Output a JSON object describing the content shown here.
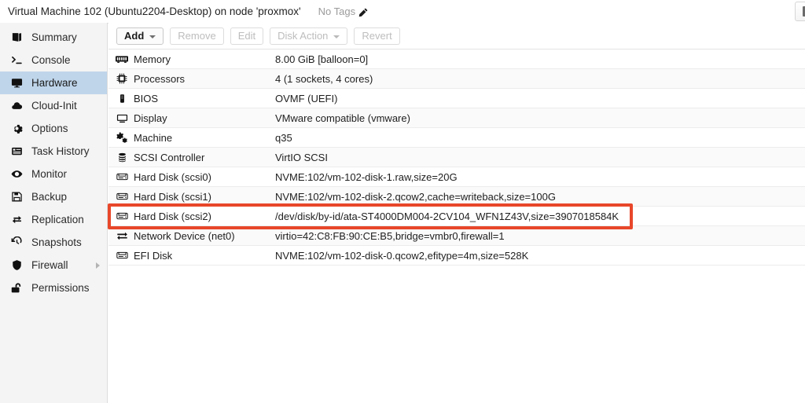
{
  "header": {
    "title": "Virtual Machine 102 (Ubuntu2204-Desktop) on node 'proxmox'",
    "tags_label": "No Tags",
    "edit_tags_icon": "pencil-icon"
  },
  "sidebar": {
    "items": [
      {
        "label": "Summary",
        "icon": "book-icon",
        "selected": false,
        "submenu": false
      },
      {
        "label": "Console",
        "icon": "terminal-icon",
        "selected": false,
        "submenu": false
      },
      {
        "label": "Hardware",
        "icon": "monitor-icon",
        "selected": true,
        "submenu": false
      },
      {
        "label": "Cloud-Init",
        "icon": "cloud-icon",
        "selected": false,
        "submenu": false
      },
      {
        "label": "Options",
        "icon": "gear-icon",
        "selected": false,
        "submenu": false
      },
      {
        "label": "Task History",
        "icon": "list-icon",
        "selected": false,
        "submenu": false
      },
      {
        "label": "Monitor",
        "icon": "eye-icon",
        "selected": false,
        "submenu": false
      },
      {
        "label": "Backup",
        "icon": "floppy-icon",
        "selected": false,
        "submenu": false
      },
      {
        "label": "Replication",
        "icon": "replication-icon",
        "selected": false,
        "submenu": false
      },
      {
        "label": "Snapshots",
        "icon": "history-icon",
        "selected": false,
        "submenu": false
      },
      {
        "label": "Firewall",
        "icon": "shield-icon",
        "selected": false,
        "submenu": true
      },
      {
        "label": "Permissions",
        "icon": "unlock-icon",
        "selected": false,
        "submenu": false
      }
    ]
  },
  "toolbar": {
    "buttons": [
      {
        "label": "Add",
        "enabled": true,
        "caret": true
      },
      {
        "label": "Remove",
        "enabled": false,
        "caret": false
      },
      {
        "label": "Edit",
        "enabled": false,
        "caret": false
      },
      {
        "label": "Disk Action",
        "enabled": false,
        "caret": true
      },
      {
        "label": "Revert",
        "enabled": false,
        "caret": false
      }
    ]
  },
  "hardware": {
    "rows": [
      {
        "icon": "memory-icon",
        "key": "Memory",
        "value": "8.00 GiB [balloon=0]"
      },
      {
        "icon": "cpu-icon",
        "key": "Processors",
        "value": "4 (1 sockets, 4 cores)"
      },
      {
        "icon": "bios-icon",
        "key": "BIOS",
        "value": "OVMF (UEFI)"
      },
      {
        "icon": "display-icon",
        "key": "Display",
        "value": "VMware compatible (vmware)"
      },
      {
        "icon": "gears-icon",
        "key": "Machine",
        "value": "q35"
      },
      {
        "icon": "database-icon",
        "key": "SCSI Controller",
        "value": "VirtIO SCSI"
      },
      {
        "icon": "harddisk-icon",
        "key": "Hard Disk (scsi0)",
        "value": "NVME:102/vm-102-disk-1.raw,size=20G"
      },
      {
        "icon": "harddisk-icon",
        "key": "Hard Disk (scsi1)",
        "value": "NVME:102/vm-102-disk-2.qcow2,cache=writeback,size=100G"
      },
      {
        "icon": "harddisk-icon",
        "key": "Hard Disk (scsi2)",
        "value": "/dev/disk/by-id/ata-ST4000DM004-2CV104_WFN1Z43V,size=3907018584K"
      },
      {
        "icon": "network-icon",
        "key": "Network Device (net0)",
        "value": "virtio=42:C8:FB:90:CE:B5,bridge=vmbr0,firewall=1"
      },
      {
        "icon": "harddisk-icon",
        "key": "EFI Disk",
        "value": "NVME:102/vm-102-disk-0.qcow2,efitype=4m,size=528K"
      }
    ]
  },
  "annotation": {
    "color": "#e8472a",
    "target_row_index": 8
  },
  "colors": {
    "selected_nav": "#bfd5ea",
    "sidebar_bg": "#f4f4f4",
    "row_alt": "#fafafa",
    "annotation_red": "#e8472a"
  }
}
